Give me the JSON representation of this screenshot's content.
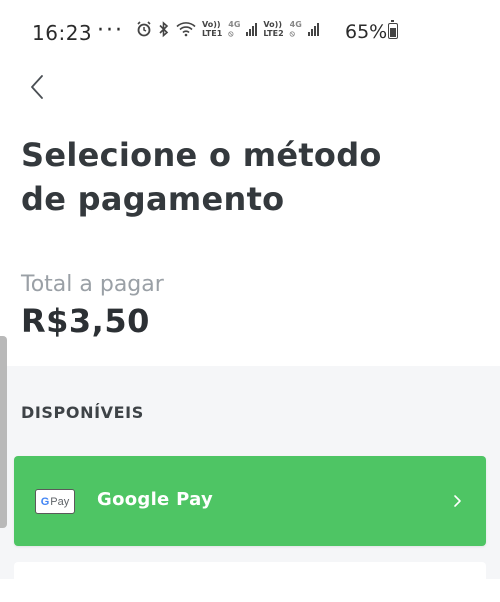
{
  "status_bar": {
    "time": "16:23",
    "overflow": "···",
    "sim1_top": "Vo))",
    "sim1_bottom": "LTE1",
    "sim2_top": "Vo))",
    "sim2_bottom": "LTE2",
    "net1": "4G",
    "net2": "4G",
    "battery_percent": "65%",
    "icons": [
      "alarm-icon",
      "bluetooth-icon",
      "wifi-icon",
      "signal-icon",
      "battery-icon"
    ]
  },
  "header": {
    "back_icon": "chevron-left-icon",
    "title": "Selecione o método de pagamento"
  },
  "total": {
    "label": "Total a pagar",
    "amount": "R$3,50"
  },
  "methods": {
    "section_title": "DISPONÍVEIS",
    "items": [
      {
        "badge_g": "G",
        "badge_text": "Pay",
        "label": "Google Pay",
        "icon": "google-pay-icon",
        "color": "#4ec564"
      }
    ]
  },
  "colors": {
    "accent_green": "#4ec564",
    "title_text": "#34393d",
    "muted_text": "#9aa0a6",
    "section_bg": "#f5f6f8"
  }
}
